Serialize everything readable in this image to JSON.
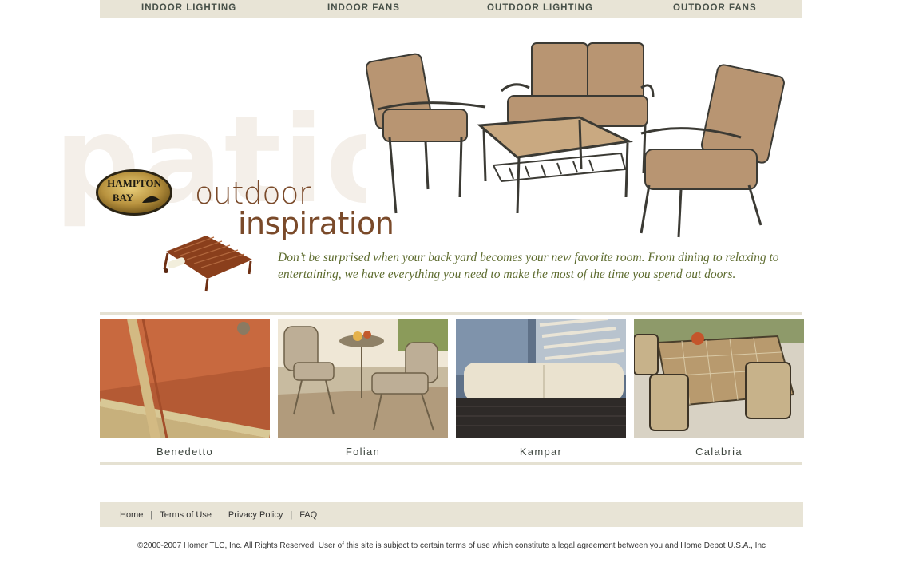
{
  "nav": [
    {
      "label": "INDOOR LIGHTING"
    },
    {
      "label": "INDOOR FANS"
    },
    {
      "label": "OUTDOOR LIGHTING"
    },
    {
      "label": "OUTDOOR FANS"
    }
  ],
  "hero": {
    "bg_word": "patio",
    "logo_text_1": "HAMPTON",
    "logo_text_2": "BAY",
    "tagline_1": "outdoor",
    "tagline_2": "inspiration",
    "description": "Don’t be surprised when your back yard becomes your new favorite room. From dining to relaxing to entertaining, we have everything you need to make the most of the time you spend out doors."
  },
  "products": [
    {
      "label": "Benedetto"
    },
    {
      "label": "Folian"
    },
    {
      "label": "Kampar"
    },
    {
      "label": "Calabria"
    }
  ],
  "footer": {
    "links": [
      {
        "label": "Home"
      },
      {
        "label": "Terms of Use"
      },
      {
        "label": "Privacy Policy"
      },
      {
        "label": "FAQ"
      }
    ],
    "copyright_pre": "©2000-2007 Homer TLC, Inc. All Rights Reserved. User of this site is subject to certain ",
    "copyright_link": "terms of use",
    "copyright_post": " which constitute a legal agreement between you and Home Depot U.S.A., Inc"
  },
  "colors": {
    "nav_bg": "#e8e4d6",
    "tagline": "#7a4a2a",
    "description": "#5d6b2e"
  }
}
